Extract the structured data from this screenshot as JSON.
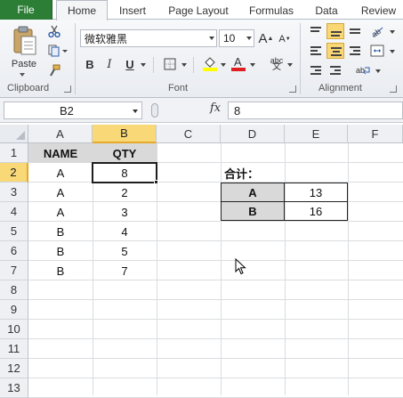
{
  "tabs": {
    "file": "File",
    "items": [
      "Home",
      "Insert",
      "Page Layout",
      "Formulas",
      "Data",
      "Review"
    ],
    "active": "Home"
  },
  "ribbon": {
    "clipboard": {
      "label": "Clipboard",
      "paste": "Paste"
    },
    "font": {
      "label": "Font",
      "font_name": "微软雅黑",
      "font_size": "10",
      "bold": "B",
      "italic": "I",
      "underline": "U",
      "abc": "abc",
      "grow": "A",
      "shrink": "A"
    },
    "alignment": {
      "label": "Alignment"
    }
  },
  "formula_bar": {
    "name_box": "B2",
    "fx": "fx",
    "value": "8"
  },
  "columns": [
    "A",
    "B",
    "C",
    "D",
    "E",
    "F"
  ],
  "rows": [
    "1",
    "2",
    "3",
    "4",
    "5",
    "6",
    "7",
    "8",
    "9",
    "10",
    "11",
    "12",
    "13"
  ],
  "table": {
    "headers": [
      "NAME",
      "QTY"
    ],
    "rows": [
      [
        "A",
        "8"
      ],
      [
        "A",
        "2"
      ],
      [
        "A",
        "3"
      ],
      [
        "B",
        "4"
      ],
      [
        "B",
        "5"
      ],
      [
        "B",
        "7"
      ]
    ]
  },
  "summary": {
    "title": "合计：",
    "rows": [
      [
        "A",
        "13"
      ],
      [
        "B",
        "16"
      ]
    ]
  },
  "colors": {
    "file_tab": "#2c7d36",
    "selection": "#f8d877",
    "header_fill": "#d9d9d9",
    "font_color_bar": "#e02020",
    "highlight_bar": "#ffff00"
  }
}
